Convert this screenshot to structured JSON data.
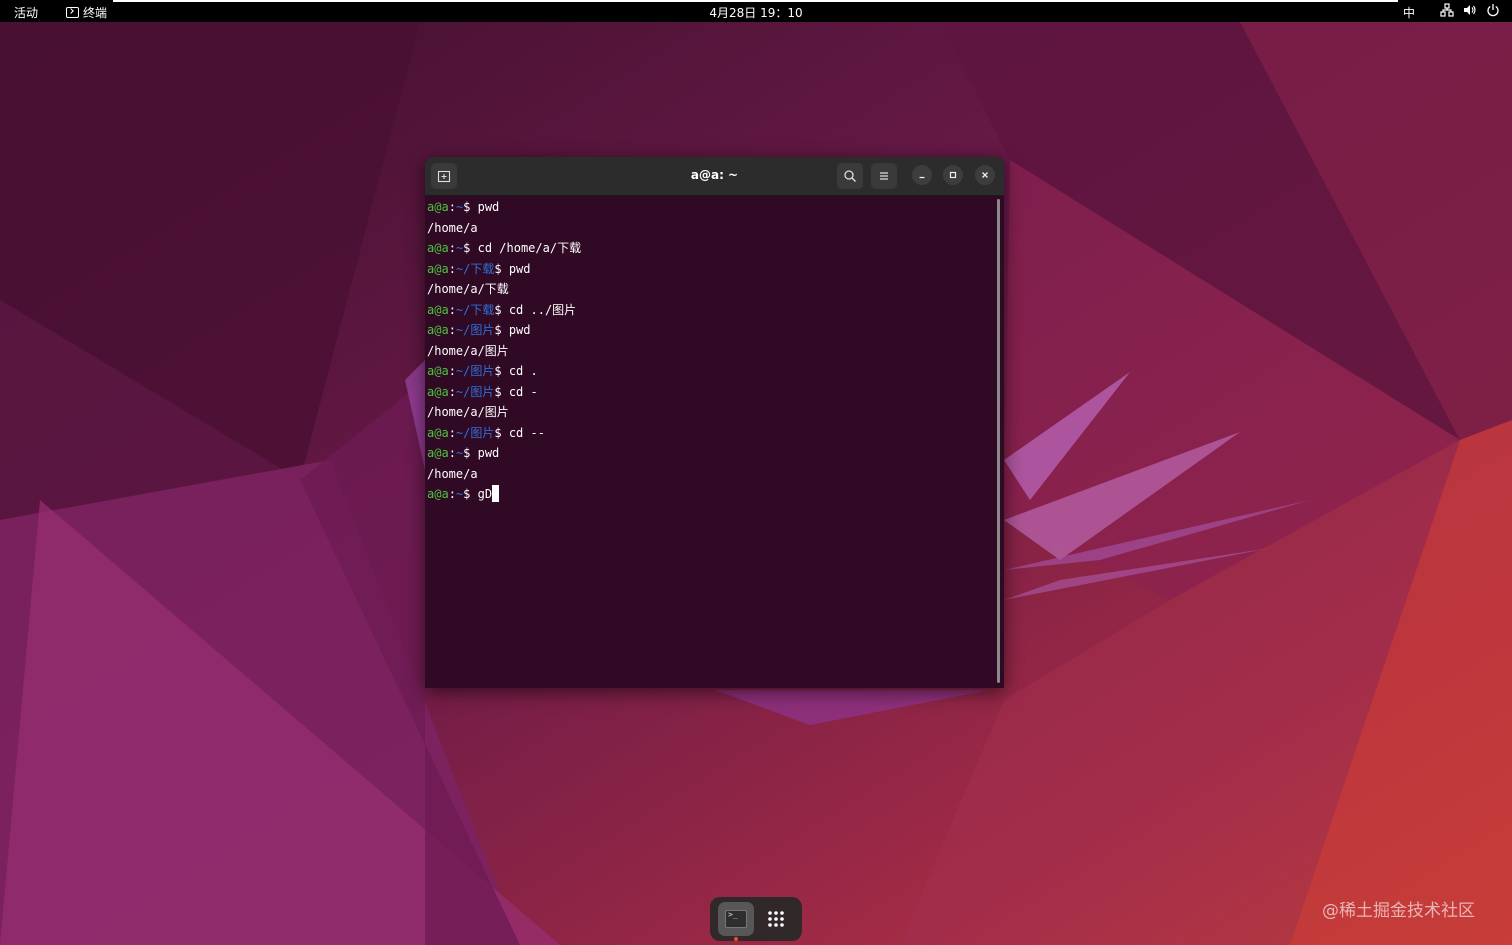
{
  "topbar": {
    "activities": "活动",
    "app_name": "终端",
    "clock": "4月28日 19：10",
    "input_method": "中"
  },
  "terminal": {
    "title": "a@a: ~",
    "lines": [
      {
        "user": "a@a",
        "sep": ":",
        "path": "~",
        "prompt": "$ ",
        "cmd": "pwd"
      },
      {
        "output": "/home/a"
      },
      {
        "user": "a@a",
        "sep": ":",
        "path": "~",
        "prompt": "$ ",
        "cmd": "cd /home/a/下载"
      },
      {
        "user": "a@a",
        "sep": ":",
        "path": "~/下载",
        "prompt": "$ ",
        "cmd": "pwd"
      },
      {
        "output": "/home/a/下载"
      },
      {
        "user": "a@a",
        "sep": ":",
        "path": "~/下载",
        "prompt": "$ ",
        "cmd": "cd ../图片"
      },
      {
        "user": "a@a",
        "sep": ":",
        "path": "~/图片",
        "prompt": "$ ",
        "cmd": "pwd"
      },
      {
        "output": "/home/a/图片"
      },
      {
        "user": "a@a",
        "sep": ":",
        "path": "~/图片",
        "prompt": "$ ",
        "cmd": "cd ."
      },
      {
        "user": "a@a",
        "sep": ":",
        "path": "~/图片",
        "prompt": "$ ",
        "cmd": "cd -"
      },
      {
        "output": "/home/a/图片"
      },
      {
        "user": "a@a",
        "sep": ":",
        "path": "~/图片",
        "prompt": "$ ",
        "cmd": "cd --"
      },
      {
        "user": "a@a",
        "sep": ":",
        "path": "~",
        "prompt": "$ ",
        "cmd": "pwd"
      },
      {
        "output": "/home/a"
      },
      {
        "user": "a@a",
        "sep": ":",
        "path": "~",
        "prompt": "$ ",
        "cmd": "gD",
        "cursor": true
      }
    ]
  },
  "watermark": "@稀土掘金技术社区",
  "icons": {
    "new_tab": "new-tab-icon",
    "search": "search-icon",
    "menu": "hamburger-menu-icon",
    "minimize": "minimize-icon",
    "maximize": "maximize-icon",
    "close": "close-icon",
    "network": "network-icon",
    "volume": "volume-icon",
    "power": "power-icon",
    "show_apps": "grid-apps-icon"
  },
  "colors": {
    "terminal_bg": "#300a24",
    "prompt_user": "#4ec140",
    "prompt_path": "#2f6fd8",
    "header_bg": "#2c2c2c"
  }
}
